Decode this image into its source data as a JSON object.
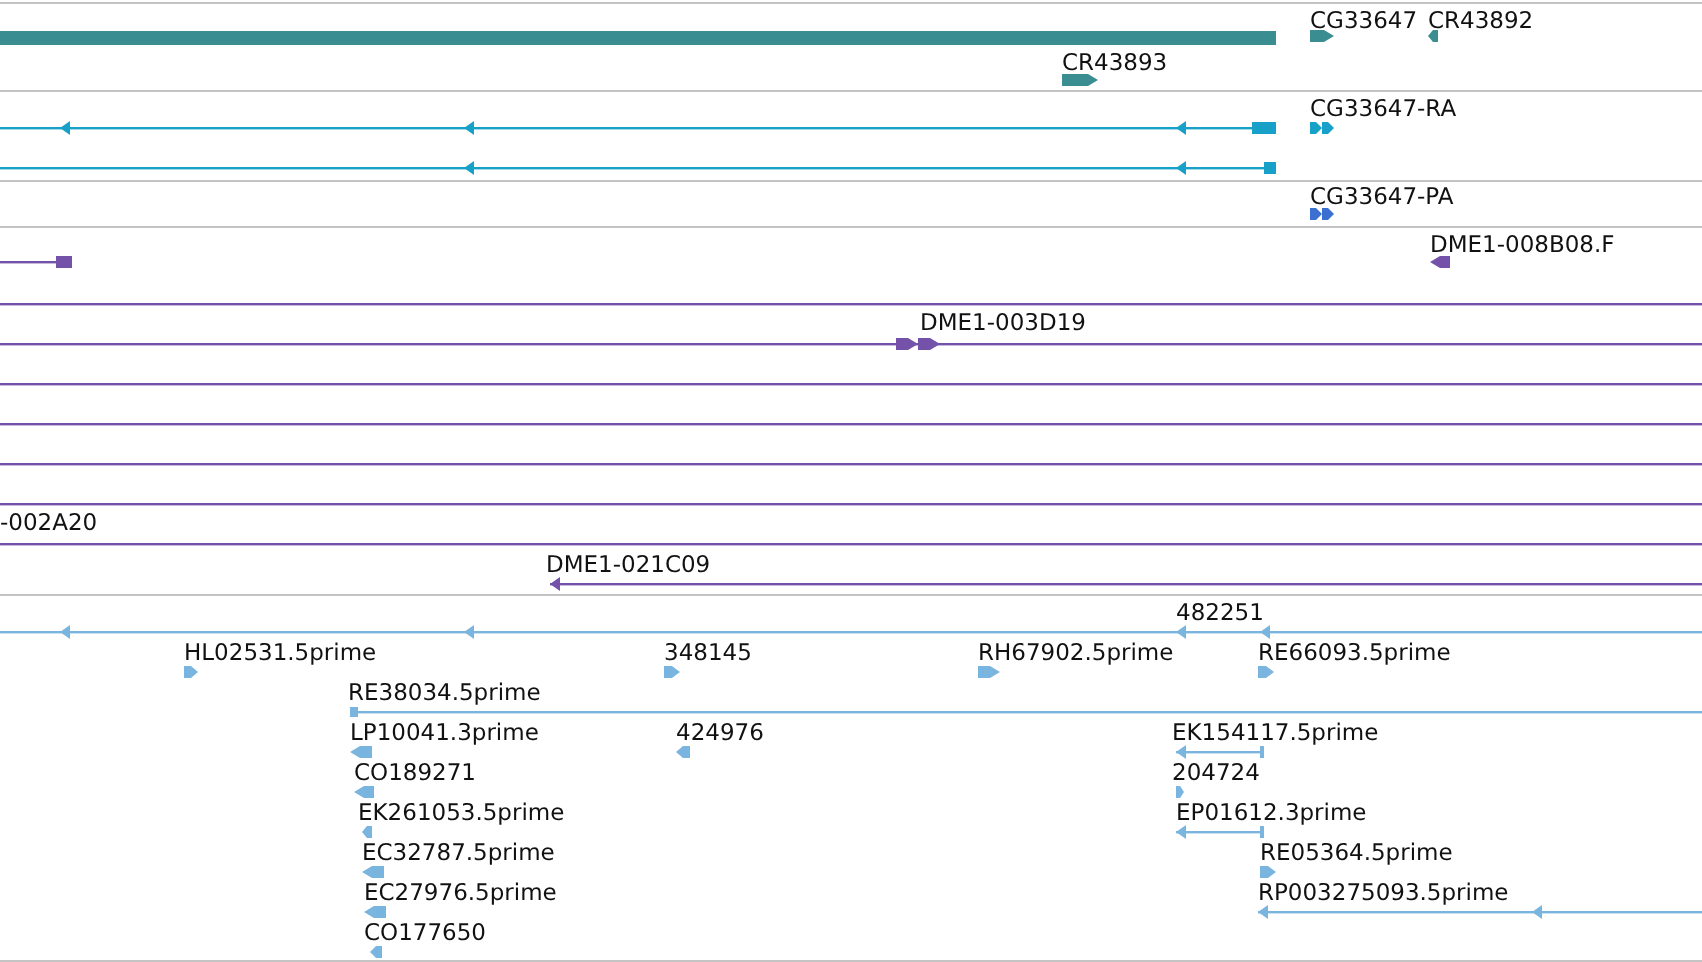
{
  "tracks": [
    {
      "color": "#3a8d90",
      "labels": [
        "CG33647",
        "CR43892",
        "CR43893"
      ]
    },
    {
      "color": "#17a0c8",
      "labels": [
        "CG33647-RA"
      ]
    },
    {
      "color": "#3b6fd0",
      "labels": [
        "CG33647-PA"
      ]
    },
    {
      "color": "#7452aa",
      "labels": [
        "DME1-008B08.F",
        "DME1-003D19",
        "-002A20",
        "DME1-021C09"
      ]
    },
    {
      "color": "#7ab5df",
      "labels": [
        "482251",
        "HL02531.5prime",
        "348145",
        "RH67902.5prime",
        "RE66093.5prime",
        "RE38034.5prime",
        "LP10041.3prime",
        "424976",
        "EK154117.5prime",
        "CO189271",
        "204724",
        "EK261053.5prime",
        "EP01612.3prime",
        "EC32787.5prime",
        "RE05364.5prime",
        "EC27976.5prime",
        "RP003275093.5prime",
        "CO177650"
      ]
    }
  ]
}
